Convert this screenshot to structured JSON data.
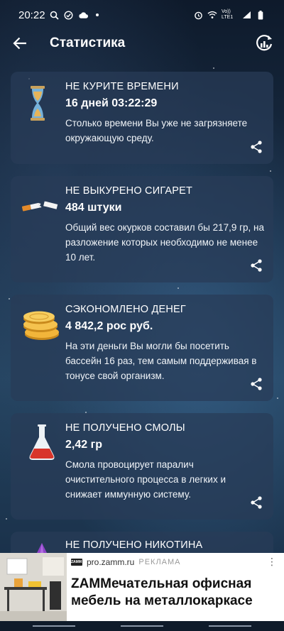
{
  "status_bar": {
    "time": "20:22",
    "network": "Vo)) LTE1",
    "icons": [
      "search-icon",
      "check-circle-icon",
      "cloud-icon",
      "dot-icon",
      "alarm-icon",
      "wifi-icon",
      "signal-icon",
      "battery-icon"
    ]
  },
  "app_bar": {
    "title": "Статистика",
    "back_icon": "arrow-left-icon",
    "action_icon": "chart-refresh-icon"
  },
  "cards": [
    {
      "heading": "НЕ КУРИТЕ ВРЕМЕНИ",
      "value": "16 дней 03:22:29",
      "description": "Столько времени Вы уже не загрязняете окружающую среду.",
      "icon": "hourglass-icon"
    },
    {
      "heading": "НЕ ВЫКУРЕНО СИГАРЕТ",
      "value": "484 штуки",
      "description": "Общий вес окурков составил бы 217,9 гр, на разложение которых необходимо не менее 10 лет.",
      "icon": "broken-cigarette-icon"
    },
    {
      "heading": "СЭКОНОМЛЕНО ДЕНЕГ",
      "value": "4 842,2 рос руб.",
      "description": "На эти деньги Вы могли бы посетить бассейн 16 раз, тем самым поддерживая в тонусе свой организм.",
      "icon": "coins-icon"
    },
    {
      "heading": "НЕ ПОЛУЧЕНО СМОЛЫ",
      "value": "2,42 гр",
      "description": "Смола провоцирует паралич очистительного процесса в легких и снижает иммунную систему.",
      "icon": "flask-icon"
    },
    {
      "heading": "НЕ ПОЛУЧЕНО НИКОТИНА",
      "icon": "purple-crystal-icon"
    }
  ],
  "ad": {
    "logo_text": "ZAMM",
    "domain": "pro.zamm.ru",
    "label": "РЕКЛАМА",
    "headline": "ZAMMечательная офисная мебель на металлокаркасе",
    "more_icon": "more-vertical-icon"
  },
  "colors": {
    "card_bg": "#283c58",
    "accent_gold": "#f2b53a",
    "flask_red": "#d8352a",
    "hourglass_sand": "#e6b55a",
    "hourglass_glass": "#7fc0ea"
  }
}
